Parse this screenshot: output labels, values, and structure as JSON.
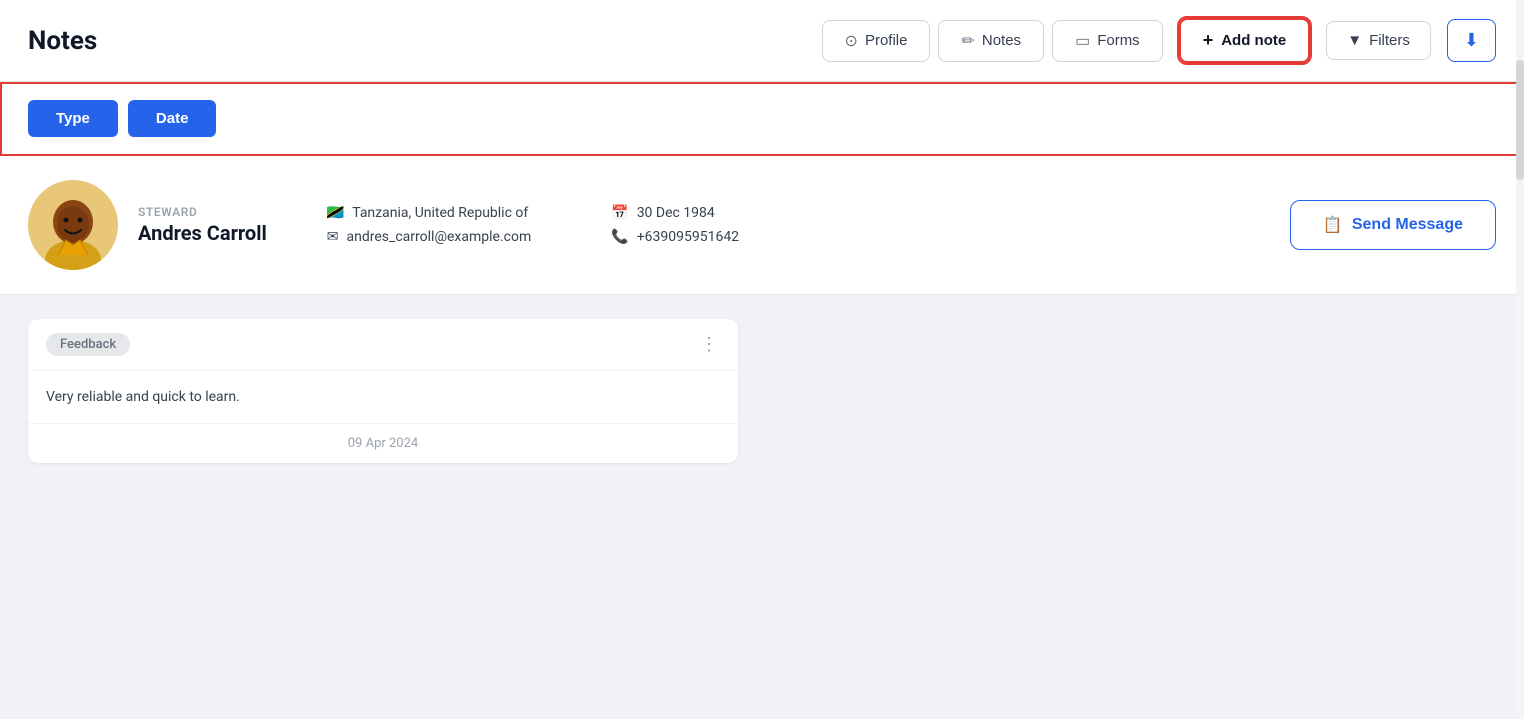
{
  "header": {
    "title": "Notes",
    "tabs": [
      {
        "id": "profile",
        "label": "Profile",
        "icon": "⊙"
      },
      {
        "id": "notes",
        "label": "Notes",
        "icon": "✏"
      },
      {
        "id": "forms",
        "label": "Forms",
        "icon": "▭"
      }
    ],
    "add_note_label": "Add note",
    "filters_label": "Filters",
    "download_icon": "⬇"
  },
  "filter_row": {
    "type_label": "Type",
    "date_label": "Date"
  },
  "profile": {
    "role": "STEWARD",
    "name": "Andres Carroll",
    "country": "Tanzania, United Republic of",
    "email": "andres_carroll@example.com",
    "dob": "30 Dec 1984",
    "phone": "+639095951642",
    "send_message_label": "Send Message"
  },
  "note": {
    "tag": "Feedback",
    "body": "Very reliable and quick to learn.",
    "date": "09 Apr 2024"
  },
  "colors": {
    "primary": "#2563eb",
    "highlight": "#e53935",
    "btn_active": "#2563eb",
    "tag_bg": "#e5e7eb",
    "tag_text": "#6b7280"
  }
}
